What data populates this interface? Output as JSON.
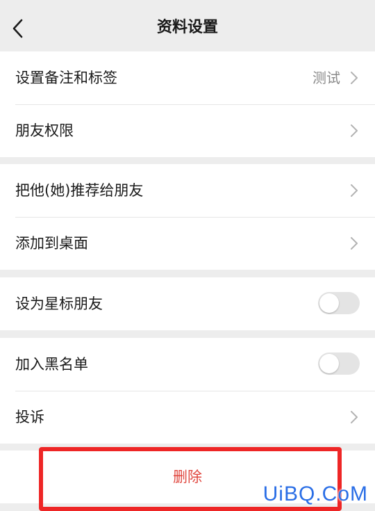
{
  "header": {
    "title": "资料设置",
    "back_icon": "chevron-left-icon"
  },
  "groups": [
    {
      "rows": [
        {
          "label": "设置备注和标签",
          "value": "测试",
          "accessory": "chevron-right-icon"
        },
        {
          "label": "朋友权限",
          "accessory": "chevron-right-icon"
        }
      ]
    },
    {
      "rows": [
        {
          "label": "把他(她)推荐给朋友",
          "accessory": "chevron-right-icon"
        },
        {
          "label": "添加到桌面",
          "accessory": "chevron-right-icon"
        }
      ]
    },
    {
      "rows": [
        {
          "label": "设为星标朋友",
          "accessory": "toggle",
          "toggle_on": false
        }
      ]
    },
    {
      "rows": [
        {
          "label": "加入黑名单",
          "accessory": "toggle",
          "toggle_on": false
        },
        {
          "label": "投诉",
          "accessory": "chevron-right-icon"
        }
      ]
    }
  ],
  "delete": {
    "label": "删除",
    "color": "#e0473f"
  },
  "highlight": {
    "color": "#ee2626"
  },
  "watermark": {
    "text": "UiBQ.CoM"
  }
}
